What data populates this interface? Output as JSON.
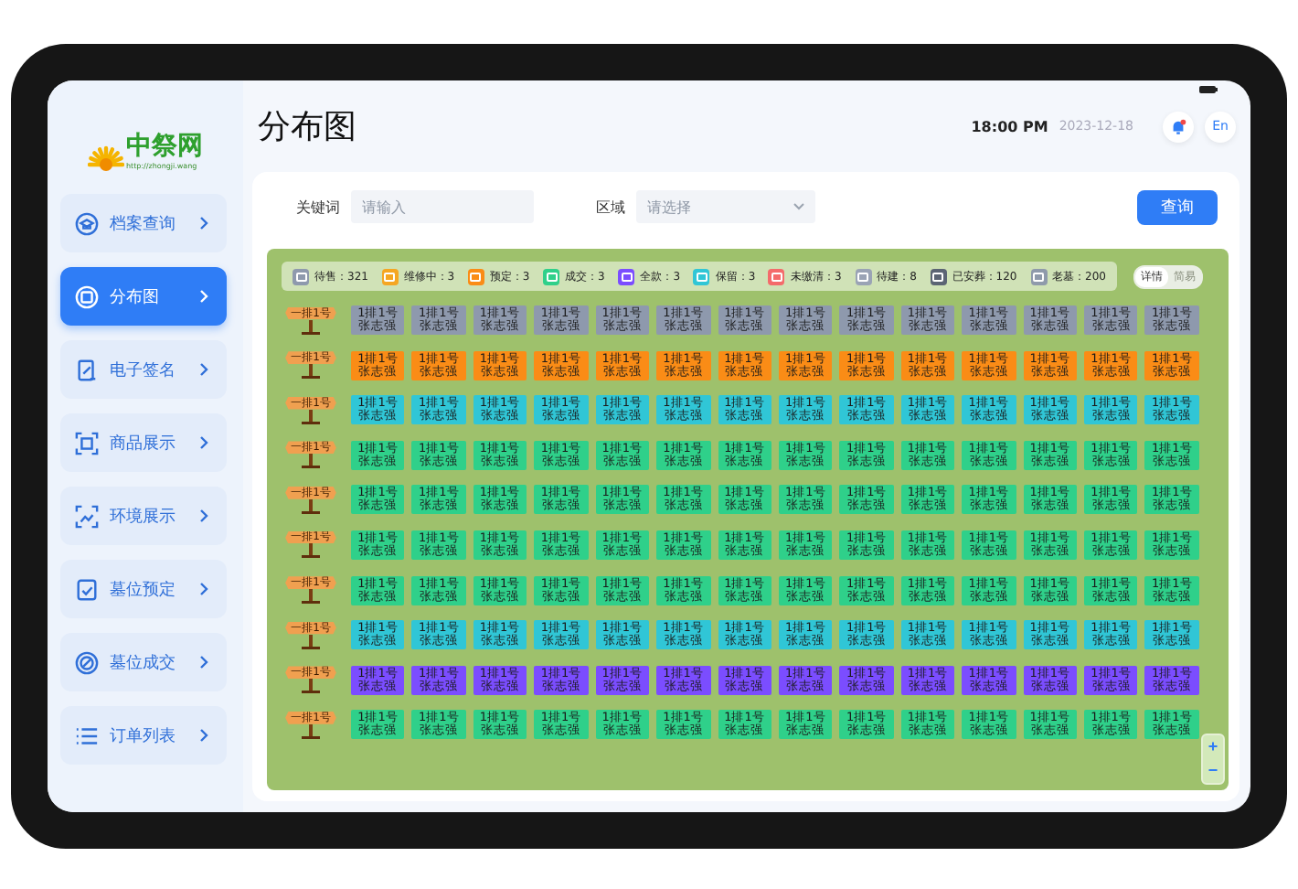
{
  "logo": {
    "name": "中祭网",
    "url": "http://zhongji.wang"
  },
  "sidebar": {
    "items": [
      {
        "label": "档案查询",
        "selected": false
      },
      {
        "label": "分布图",
        "selected": true
      },
      {
        "label": "电子签名",
        "selected": false
      },
      {
        "label": "商品展示",
        "selected": false
      },
      {
        "label": "环境展示",
        "selected": false
      },
      {
        "label": "墓位预定",
        "selected": false
      },
      {
        "label": "墓位成交",
        "selected": false
      },
      {
        "label": "订单列表",
        "selected": false
      }
    ]
  },
  "header": {
    "title": "分布图",
    "time": "18:00 PM",
    "date": "2023-12-18",
    "language": "En"
  },
  "search": {
    "keyword_label": "关键词",
    "keyword_placeholder": "请输入",
    "area_label": "区域",
    "area_placeholder": "请选择",
    "button": "查询"
  },
  "legend": [
    {
      "kind": "sale",
      "label": "待售：321",
      "color": "#8e99ad"
    },
    {
      "kind": "repair",
      "label": "维修中：3",
      "color": "#f5a623"
    },
    {
      "kind": "reserved",
      "label": "预定：3",
      "color": "#fa8c16"
    },
    {
      "kind": "deal",
      "label": "成交：3",
      "color": "#2fd08a"
    },
    {
      "kind": "full",
      "label": "全款：3",
      "color": "#7b4dff"
    },
    {
      "kind": "keep",
      "label": "保留：3",
      "color": "#30c6d6"
    },
    {
      "kind": "unpaid",
      "label": "未缴清：3",
      "color": "#f46b6b"
    },
    {
      "kind": "pending",
      "label": "待建：8",
      "color": "#9aa3b5"
    },
    {
      "kind": "buried",
      "label": "已安葬：120",
      "color": "#5b6474"
    },
    {
      "kind": "old",
      "label": "老墓：200",
      "color": "#8f9aab"
    }
  ],
  "view_toggle": [
    {
      "label": "详情",
      "selected": true
    },
    {
      "label": "简易",
      "selected": false
    }
  ],
  "zoom": {
    "in": "+",
    "out": "−"
  },
  "rows": [
    {
      "sign": "一排1号",
      "kind": "sale",
      "cells": [
        {
          "seat": "1排1号",
          "name": "张志强"
        },
        {
          "seat": "1排1号",
          "name": "张志强"
        },
        {
          "seat": "1排1号",
          "name": "张志强"
        },
        {
          "seat": "1排1号",
          "name": "张志强"
        },
        {
          "seat": "1排1号",
          "name": "张志强"
        },
        {
          "seat": "1排1号",
          "name": "张志强"
        },
        {
          "seat": "1排1号",
          "name": "张志强"
        },
        {
          "seat": "1排1号",
          "name": "张志强"
        },
        {
          "seat": "1排1号",
          "name": "张志强"
        },
        {
          "seat": "1排1号",
          "name": "张志强"
        },
        {
          "seat": "1排1号",
          "name": "张志强"
        },
        {
          "seat": "1排1号",
          "name": "张志强"
        },
        {
          "seat": "1排1号",
          "name": "张志强"
        },
        {
          "seat": "1排1号",
          "name": "张志强"
        }
      ]
    },
    {
      "sign": "一排1号",
      "kind": "reserved",
      "cells": [
        {
          "seat": "1排1号",
          "name": "张志强"
        },
        {
          "seat": "1排1号",
          "name": "张志强"
        },
        {
          "seat": "1排1号",
          "name": "张志强"
        },
        {
          "seat": "1排1号",
          "name": "张志强"
        },
        {
          "seat": "1排1号",
          "name": "张志强"
        },
        {
          "seat": "1排1号",
          "name": "张志强"
        },
        {
          "seat": "1排1号",
          "name": "张志强"
        },
        {
          "seat": "1排1号",
          "name": "张志强"
        },
        {
          "seat": "1排1号",
          "name": "张志强"
        },
        {
          "seat": "1排1号",
          "name": "张志强"
        },
        {
          "seat": "1排1号",
          "name": "张志强"
        },
        {
          "seat": "1排1号",
          "name": "张志强"
        },
        {
          "seat": "1排1号",
          "name": "张志强"
        },
        {
          "seat": "1排1号",
          "name": "张志强"
        }
      ]
    },
    {
      "sign": "一排1号",
      "kind": "keep",
      "cells": [
        {
          "seat": "1排1号",
          "name": "张志强"
        },
        {
          "seat": "1排1号",
          "name": "张志强"
        },
        {
          "seat": "1排1号",
          "name": "张志强"
        },
        {
          "seat": "1排1号",
          "name": "张志强"
        },
        {
          "seat": "1排1号",
          "name": "张志强"
        },
        {
          "seat": "1排1号",
          "name": "张志强"
        },
        {
          "seat": "1排1号",
          "name": "张志强"
        },
        {
          "seat": "1排1号",
          "name": "张志强"
        },
        {
          "seat": "1排1号",
          "name": "张志强"
        },
        {
          "seat": "1排1号",
          "name": "张志强"
        },
        {
          "seat": "1排1号",
          "name": "张志强"
        },
        {
          "seat": "1排1号",
          "name": "张志强"
        },
        {
          "seat": "1排1号",
          "name": "张志强"
        },
        {
          "seat": "1排1号",
          "name": "张志强"
        }
      ]
    },
    {
      "sign": "一排1号",
      "kind": "deal",
      "cells": [
        {
          "seat": "1排1号",
          "name": "张志强"
        },
        {
          "seat": "1排1号",
          "name": "张志强"
        },
        {
          "seat": "1排1号",
          "name": "张志强"
        },
        {
          "seat": "1排1号",
          "name": "张志强"
        },
        {
          "seat": "1排1号",
          "name": "张志强"
        },
        {
          "seat": "1排1号",
          "name": "张志强"
        },
        {
          "seat": "1排1号",
          "name": "张志强"
        },
        {
          "seat": "1排1号",
          "name": "张志强"
        },
        {
          "seat": "1排1号",
          "name": "张志强"
        },
        {
          "seat": "1排1号",
          "name": "张志强"
        },
        {
          "seat": "1排1号",
          "name": "张志强"
        },
        {
          "seat": "1排1号",
          "name": "张志强"
        },
        {
          "seat": "1排1号",
          "name": "张志强"
        },
        {
          "seat": "1排1号",
          "name": "张志强"
        }
      ]
    },
    {
      "sign": "一排1号",
      "kind": "deal",
      "cells": [
        {
          "seat": "1排1号",
          "name": "张志强"
        },
        {
          "seat": "1排1号",
          "name": "张志强"
        },
        {
          "seat": "1排1号",
          "name": "张志强"
        },
        {
          "seat": "1排1号",
          "name": "张志强"
        },
        {
          "seat": "1排1号",
          "name": "张志强"
        },
        {
          "seat": "1排1号",
          "name": "张志强"
        },
        {
          "seat": "1排1号",
          "name": "张志强"
        },
        {
          "seat": "1排1号",
          "name": "张志强"
        },
        {
          "seat": "1排1号",
          "name": "张志强"
        },
        {
          "seat": "1排1号",
          "name": "张志强"
        },
        {
          "seat": "1排1号",
          "name": "张志强"
        },
        {
          "seat": "1排1号",
          "name": "张志强"
        },
        {
          "seat": "1排1号",
          "name": "张志强"
        },
        {
          "seat": "1排1号",
          "name": "张志强"
        }
      ]
    },
    {
      "sign": "一排1号",
      "kind": "deal",
      "cells": [
        {
          "seat": "1排1号",
          "name": "张志强"
        },
        {
          "seat": "1排1号",
          "name": "张志强"
        },
        {
          "seat": "1排1号",
          "name": "张志强"
        },
        {
          "seat": "1排1号",
          "name": "张志强"
        },
        {
          "seat": "1排1号",
          "name": "张志强"
        },
        {
          "seat": "1排1号",
          "name": "张志强"
        },
        {
          "seat": "1排1号",
          "name": "张志强"
        },
        {
          "seat": "1排1号",
          "name": "张志强"
        },
        {
          "seat": "1排1号",
          "name": "张志强"
        },
        {
          "seat": "1排1号",
          "name": "张志强"
        },
        {
          "seat": "1排1号",
          "name": "张志强"
        },
        {
          "seat": "1排1号",
          "name": "张志强"
        },
        {
          "seat": "1排1号",
          "name": "张志强"
        },
        {
          "seat": "1排1号",
          "name": "张志强"
        }
      ]
    },
    {
      "sign": "一排1号",
      "kind": "deal",
      "cells": [
        {
          "seat": "1排1号",
          "name": "张志强"
        },
        {
          "seat": "1排1号",
          "name": "张志强"
        },
        {
          "seat": "1排1号",
          "name": "张志强"
        },
        {
          "seat": "1排1号",
          "name": "张志强"
        },
        {
          "seat": "1排1号",
          "name": "张志强"
        },
        {
          "seat": "1排1号",
          "name": "张志强"
        },
        {
          "seat": "1排1号",
          "name": "张志强"
        },
        {
          "seat": "1排1号",
          "name": "张志强"
        },
        {
          "seat": "1排1号",
          "name": "张志强"
        },
        {
          "seat": "1排1号",
          "name": "张志强"
        },
        {
          "seat": "1排1号",
          "name": "张志强"
        },
        {
          "seat": "1排1号",
          "name": "张志强"
        },
        {
          "seat": "1排1号",
          "name": "张志强"
        },
        {
          "seat": "1排1号",
          "name": "张志强"
        }
      ]
    },
    {
      "sign": "一排1号",
      "kind": "keep",
      "cells": [
        {
          "seat": "1排1号",
          "name": "张志强"
        },
        {
          "seat": "1排1号",
          "name": "张志强"
        },
        {
          "seat": "1排1号",
          "name": "张志强"
        },
        {
          "seat": "1排1号",
          "name": "张志强"
        },
        {
          "seat": "1排1号",
          "name": "张志强"
        },
        {
          "seat": "1排1号",
          "name": "张志强"
        },
        {
          "seat": "1排1号",
          "name": "张志强"
        },
        {
          "seat": "1排1号",
          "name": "张志强"
        },
        {
          "seat": "1排1号",
          "name": "张志强"
        },
        {
          "seat": "1排1号",
          "name": "张志强"
        },
        {
          "seat": "1排1号",
          "name": "张志强"
        },
        {
          "seat": "1排1号",
          "name": "张志强"
        },
        {
          "seat": "1排1号",
          "name": "张志强"
        },
        {
          "seat": "1排1号",
          "name": "张志强"
        }
      ]
    },
    {
      "sign": "一排1号",
      "kind": "full",
      "cells": [
        {
          "seat": "1排1号",
          "name": "张志强"
        },
        {
          "seat": "1排1号",
          "name": "张志强"
        },
        {
          "seat": "1排1号",
          "name": "张志强"
        },
        {
          "seat": "1排1号",
          "name": "张志强"
        },
        {
          "seat": "1排1号",
          "name": "张志强"
        },
        {
          "seat": "1排1号",
          "name": "张志强"
        },
        {
          "seat": "1排1号",
          "name": "张志强"
        },
        {
          "seat": "1排1号",
          "name": "张志强"
        },
        {
          "seat": "1排1号",
          "name": "张志强"
        },
        {
          "seat": "1排1号",
          "name": "张志强"
        },
        {
          "seat": "1排1号",
          "name": "张志强"
        },
        {
          "seat": "1排1号",
          "name": "张志强"
        },
        {
          "seat": "1排1号",
          "name": "张志强"
        },
        {
          "seat": "1排1号",
          "name": "张志强"
        }
      ]
    },
    {
      "sign": "一排1号",
      "kind": "deal",
      "cells": [
        {
          "seat": "1排1号",
          "name": "张志强"
        },
        {
          "seat": "1排1号",
          "name": "张志强"
        },
        {
          "seat": "1排1号",
          "name": "张志强"
        },
        {
          "seat": "1排1号",
          "name": "张志强"
        },
        {
          "seat": "1排1号",
          "name": "张志强"
        },
        {
          "seat": "1排1号",
          "name": "张志强"
        },
        {
          "seat": "1排1号",
          "name": "张志强"
        },
        {
          "seat": "1排1号",
          "name": "张志强"
        },
        {
          "seat": "1排1号",
          "name": "张志强"
        },
        {
          "seat": "1排1号",
          "name": "张志强"
        },
        {
          "seat": "1排1号",
          "name": "张志强"
        },
        {
          "seat": "1排1号",
          "name": "张志强"
        },
        {
          "seat": "1排1号",
          "name": "张志强"
        },
        {
          "seat": "1排1号",
          "name": "张志强"
        }
      ]
    }
  ]
}
